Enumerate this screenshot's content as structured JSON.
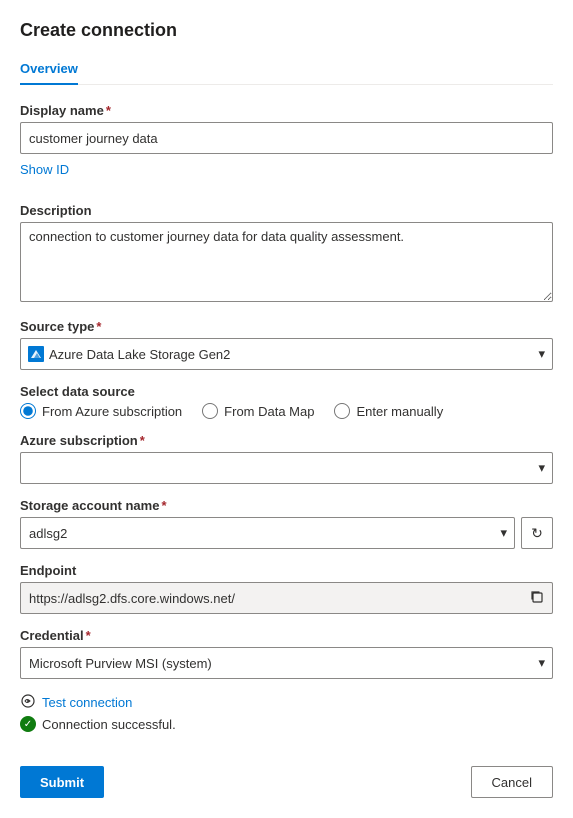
{
  "page": {
    "title": "Create connection"
  },
  "tabs": [
    {
      "id": "overview",
      "label": "Overview",
      "active": true
    }
  ],
  "form": {
    "display_name": {
      "label": "Display name",
      "required": true,
      "value": "customer journey data"
    },
    "show_id_link": "Show ID",
    "description": {
      "label": "Description",
      "required": false,
      "value": "connection to customer journey data for data quality assessment."
    },
    "source_type": {
      "label": "Source type",
      "required": true,
      "selected": "Azure Data Lake Storage Gen2",
      "options": [
        "Azure Data Lake Storage Gen2"
      ]
    },
    "data_source": {
      "label": "Select data source",
      "options": [
        {
          "id": "azure_subscription",
          "label": "From Azure subscription",
          "checked": true
        },
        {
          "id": "from_data_map",
          "label": "From Data Map",
          "checked": false
        },
        {
          "id": "enter_manually",
          "label": "Enter manually",
          "checked": false
        }
      ]
    },
    "azure_subscription": {
      "label": "Azure subscription",
      "required": true,
      "value": "",
      "placeholder": ""
    },
    "storage_account_name": {
      "label": "Storage account name",
      "required": true,
      "selected": "adlsg2",
      "options": [
        "adlsg2"
      ]
    },
    "endpoint": {
      "label": "Endpoint",
      "value": "https://adlsg2.dfs.core.windows.net/"
    },
    "credential": {
      "label": "Credential",
      "required": true,
      "selected": "Microsoft Purview MSI (system)",
      "options": [
        "Microsoft Purview MSI (system)"
      ]
    }
  },
  "test_connection": {
    "label": "Test connection",
    "success_text": "Connection successful."
  },
  "buttons": {
    "submit": "Submit",
    "cancel": "Cancel"
  },
  "icons": {
    "chevron_down": "▾",
    "refresh": "↻",
    "copy": "⧉",
    "check": "✓",
    "plug": "🔌"
  }
}
